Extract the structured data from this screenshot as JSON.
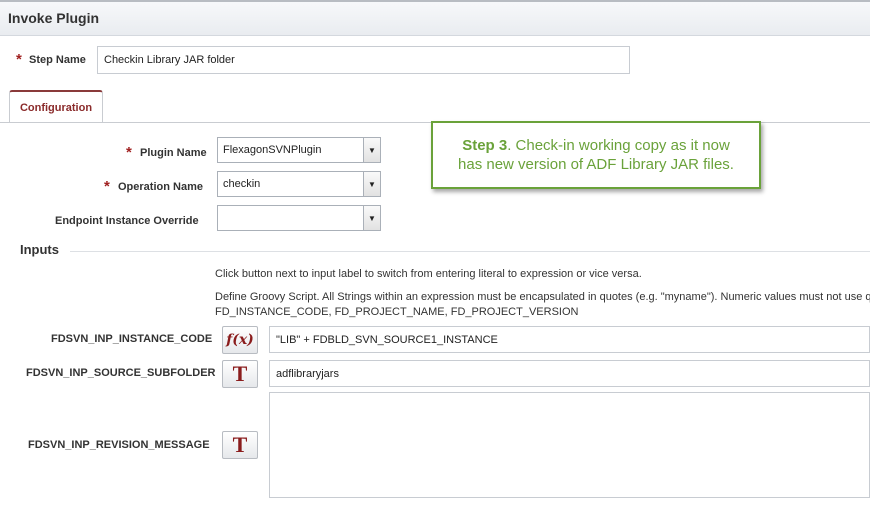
{
  "window": {
    "title": "Invoke Plugin"
  },
  "step_name": {
    "label": "Step Name",
    "required_mark": "*",
    "value": "Checkin Library JAR folder"
  },
  "tabs": [
    {
      "label": "Configuration",
      "active": true
    }
  ],
  "plugin_name": {
    "label": "Plugin Name",
    "required_mark": "*",
    "value": "FlexagonSVNPlugin"
  },
  "operation_name": {
    "label": "Operation Name",
    "required_mark": "*",
    "value": "checkin"
  },
  "endpoint_override": {
    "label": "Endpoint Instance Override",
    "value": ""
  },
  "callout": {
    "step": "Step 3",
    "line1_rest": ". Check-in working copy as it now",
    "line2": "has new version of ADF Library JAR files.",
    "color": "#6aa23a"
  },
  "inputs": {
    "heading": "Inputs",
    "help_toggle": "Click button next to input label to switch from entering literal to expression or vice versa.",
    "help_groovy": "Define Groovy Script. All Strings within an expression must be encapsulated in quotes (e.g. \"myname\"). Numeric values must not use quo",
    "help_vars": "FD_INSTANCE_CODE, FD_PROJECT_NAME, FD_PROJECT_VERSION",
    "fields": [
      {
        "label": "FDSVN_INP_INSTANCE_CODE",
        "mode": "expression",
        "mode_glyph": "f(x)",
        "value": "\"LIB\" + FDBLD_SVN_SOURCE1_INSTANCE"
      },
      {
        "label": "FDSVN_INP_SOURCE_SUBFOLDER",
        "mode": "literal",
        "mode_glyph": "T",
        "value": "adflibraryjars"
      },
      {
        "label": "FDSVN_INP_REVISION_MESSAGE",
        "mode": "literal",
        "mode_glyph": "T",
        "value": ""
      }
    ]
  },
  "colors": {
    "accent": "#8a2a2a",
    "required": "#a02020",
    "callout": "#6aa23a"
  }
}
